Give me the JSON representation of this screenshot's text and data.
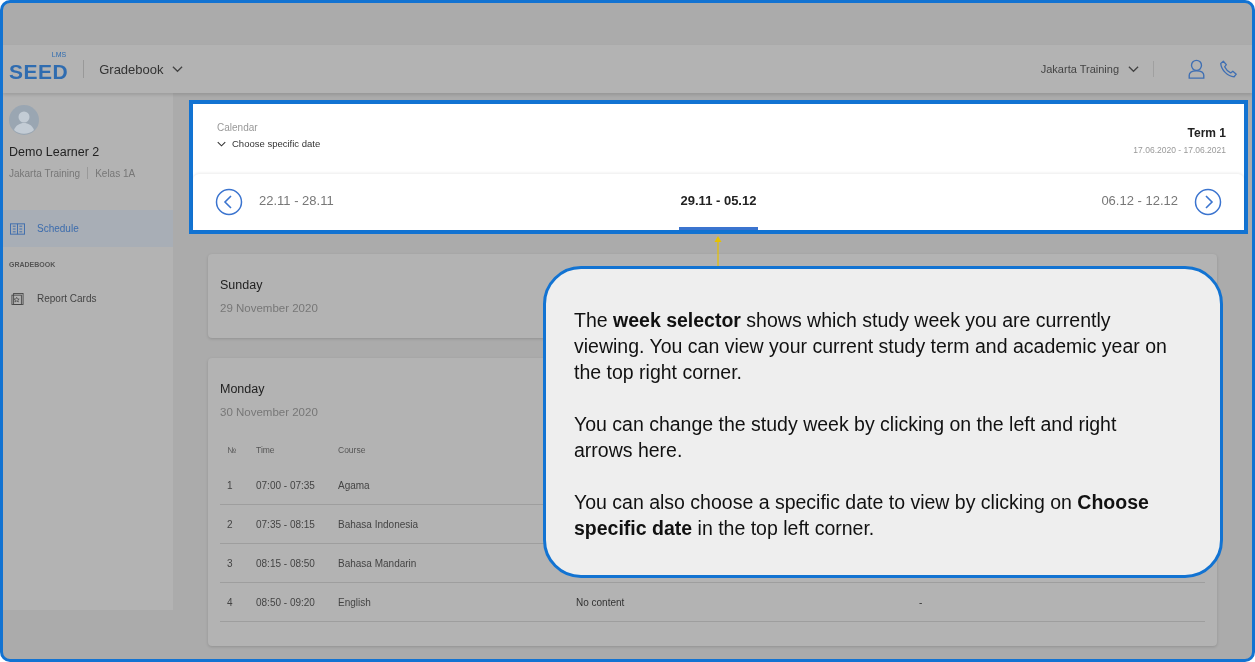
{
  "header": {
    "logo": {
      "text": "SEED",
      "superscript": "LMS"
    },
    "module": "Gradebook",
    "school": "Jakarta Training"
  },
  "sidebar": {
    "user": {
      "name": "Demo Learner 2",
      "school": "Jakarta Training",
      "class": "Kelas 1A"
    },
    "items": [
      {
        "kind": "item",
        "label": "Schedule",
        "selected": true
      },
      {
        "kind": "section",
        "label": "GRADEBOOK"
      },
      {
        "kind": "item",
        "label": "Report Cards",
        "selected": false
      }
    ]
  },
  "calendar": {
    "label": "Calendar",
    "picker": "Choose specific date",
    "term": "Term 1",
    "term_dates": "17.06.2020 - 17.06.2021",
    "weeks": [
      {
        "label": "22.11 - 28.11",
        "selected": false
      },
      {
        "label": "29.11 - 05.12",
        "selected": true
      },
      {
        "label": "06.12 - 12.12",
        "selected": false
      }
    ]
  },
  "days": [
    {
      "day": "Sunday",
      "date": "29 November 2020"
    },
    {
      "day": "Monday",
      "date": "30 November 2020",
      "table": {
        "columns": [
          "№",
          "Time",
          "Course"
        ],
        "rows": [
          {
            "number": "1",
            "time": "07:00 - 07:35",
            "course": "Agama"
          },
          {
            "number": "2",
            "time": "07:35 - 08:15",
            "course": "Bahasa Indonesia"
          },
          {
            "number": "3",
            "time": "08:15 - 08:50",
            "course": "Bahasa Mandarin"
          },
          {
            "number": "4",
            "time": "08:50 - 09:20",
            "course": "English",
            "column_4": "No content",
            "column_5": "-"
          }
        ]
      }
    }
  ],
  "tooltip": {
    "paragraphs": [
      "The **week selector** shows which study week you are currently viewing. You can view your current study term and academic year on the top right corner.",
      "You can change the study week by clicking on the left and right arrows here.",
      "You can also choose a specific date to view by clicking on **Choose specific date** in the top left corner."
    ]
  }
}
